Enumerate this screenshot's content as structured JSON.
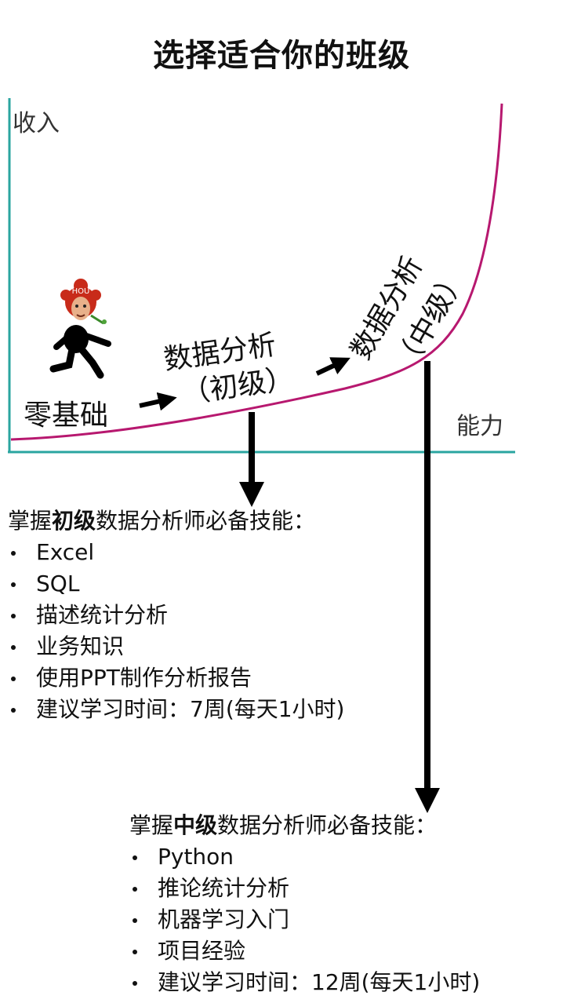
{
  "title": "选择适合你的班级",
  "axes": {
    "y": "收入",
    "x": "能力"
  },
  "stages": {
    "zero": "零基础",
    "primary": {
      "line1": "数据分析",
      "line2": "（初级）"
    },
    "intermediate": {
      "line1": "数据分析",
      "line2": "（中级）"
    }
  },
  "mascot": {
    "badge": "HOU"
  },
  "colors": {
    "axis": "#2aa5a0",
    "curve": "#b7186f",
    "arrow": "#000000"
  },
  "primary_skills": {
    "prefix": "掌握",
    "level": "初级",
    "suffix": "数据分析师必备技能：",
    "items": [
      "Excel",
      "SQL",
      "描述统计分析",
      "业务知识",
      "使用PPT制作分析报告",
      "建议学习时间：7周(每天1小时)"
    ]
  },
  "intermediate_skills": {
    "prefix": "掌握",
    "level": "中级",
    "suffix": "数据分析师必备技能：",
    "items": [
      "Python",
      "推论统计分析",
      "机器学习入门",
      "项目经验",
      "建议学习时间：12周(每天1小时)"
    ]
  }
}
